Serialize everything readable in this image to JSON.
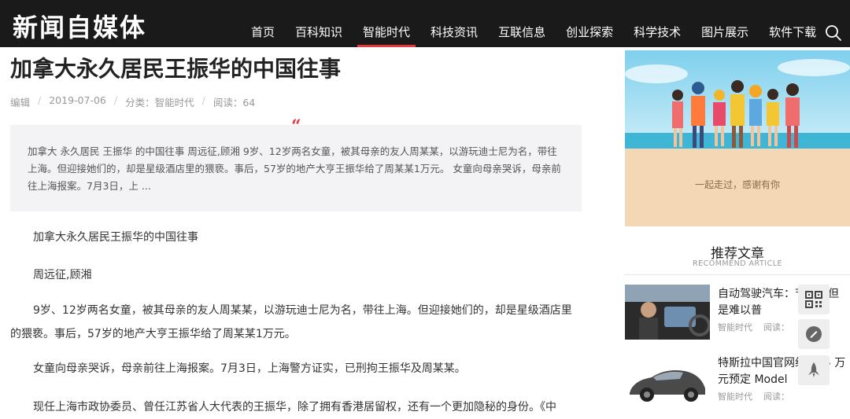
{
  "header": {
    "logo": "新闻自媒体",
    "nav": [
      "首页",
      "百科知识",
      "智能时代",
      "科技资讯",
      "互联信息",
      "创业探索",
      "科学技术",
      "图片展示",
      "软件下载"
    ],
    "active_nav": "智能时代"
  },
  "article": {
    "title": "加拿大永久居民王振华的中国往事",
    "meta": {
      "author": "编辑",
      "date": "2019-07-06",
      "category": "分类：智能时代",
      "views": "阅读：64"
    },
    "quote_mark": "“",
    "summary": "加拿大 永久居民 王振华 的中国往事 周远征,顾湘 9岁、12岁两名女童，被其母亲的友人周某某，以游玩迪士尼为名，带往上海。但迎接她们的，却是星级酒店里的猥亵。事后，57岁的地产大亨王振华给了周某某1万元。 女童向母亲哭诉，母亲前往上海报案。7月3日，上 ...",
    "paragraphs": [
      "加拿大永久居民王振华的中国往事",
      "周远征,顾湘",
      "9岁、12岁两名女童，被其母亲的友人周某某，以游玩迪士尼为名，带往上海。但迎接她们的，却是星级酒店里的猥亵。事后，57岁的地产大亨王振华给了周某某1万元。",
      "女童向母亲哭诉，母亲前往上海报案。7月3日，上海警方证实，已刑拘王振华及周某某。",
      "现任上海市政协委员、曾任江苏省人大代表的王振华，除了拥有香港居留权，还有一个更加隐秘的身份。《中"
    ]
  },
  "sidebar": {
    "banner_caption": "一起走过，感谢有你",
    "recommend_title": "推荐文章",
    "recommend_subtitle": "RECOMMEND ARTICLE",
    "items": [
      {
        "title": "自动驾驶汽车：节省，但是难以普",
        "category": "智能时代",
        "views": "阅读："
      },
      {
        "title": "特斯拉中国官网线，25 万元预定 Model",
        "category": "智能时代",
        "views": "阅读："
      }
    ]
  },
  "icons": {
    "search": "search-icon",
    "qrcode": "qrcode-icon",
    "feedback": "feedback-icon",
    "top": "rocket-icon"
  },
  "colors": {
    "header_bg": "#1a1a1a",
    "accent": "#e23b3b"
  }
}
